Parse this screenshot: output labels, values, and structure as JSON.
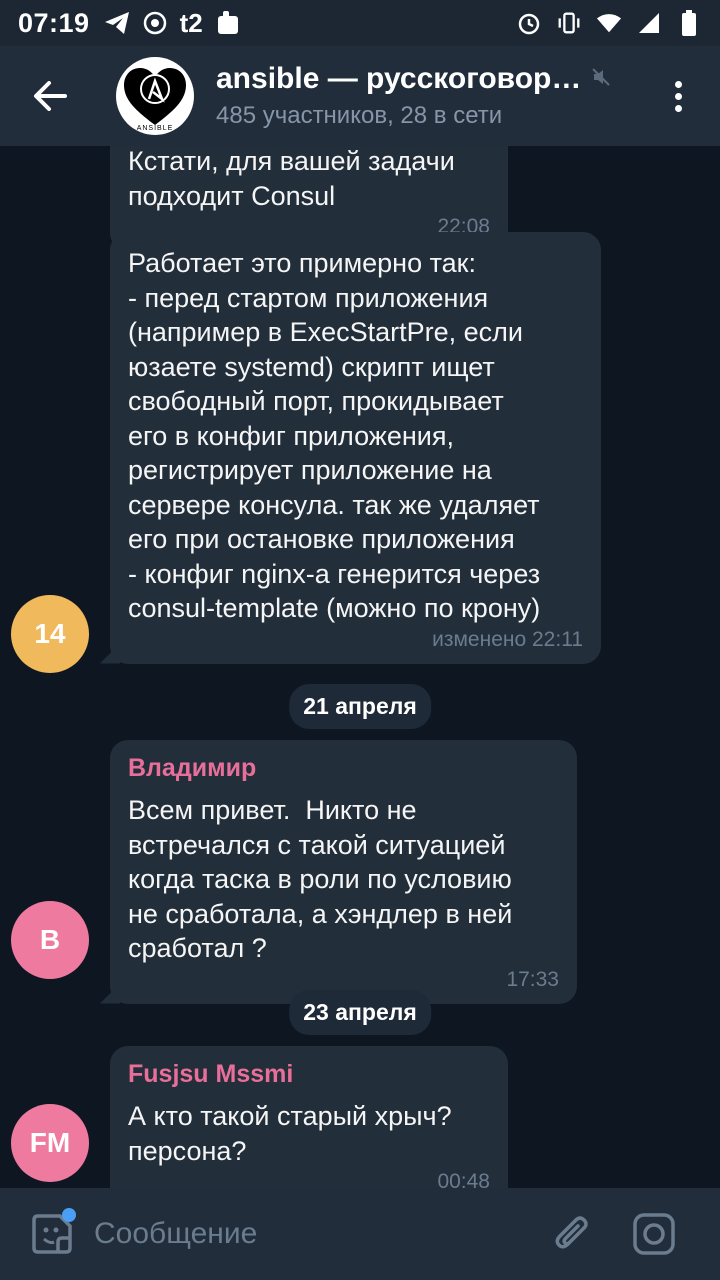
{
  "status_bar": {
    "time": "07:19",
    "carrier_badge": "t2"
  },
  "header": {
    "title": "ansible — русскоговор…",
    "subtitle": "485 участников, 28 в сети",
    "avatar_text": "ANSIBLE"
  },
  "messages": [
    {
      "text": "Кстати, для вашей задачи\nподходит Consul",
      "time": "22:08"
    },
    {
      "text": "Работает это примерно так:\n- перед стартом приложения\n(например в ExecStartPre, если\nюзаете systemd) скрипт ищет\nсвободный порт, прокидывает\nего в конфиг приложения,\nрегистрирует приложение на\nсервере консула. так же удаляет\nего при остановке приложения\n- конфиг nginx-а генерится через\nconsul-template (можно по крону)",
      "time": "изменено 22:11",
      "avatar_label": "14",
      "avatar_color": "#f0b95b"
    },
    {
      "date": "21 апреля"
    },
    {
      "sender": "Владимир",
      "text": "Всем привет.  Никто не\nвстречался с такой ситуацией\nкогда таска в роли по условию\nне сработала, а хэндлер в ней\nсработал ?",
      "time": "17:33",
      "avatar_label": "В",
      "avatar_color": "#ee7aa0"
    },
    {
      "date": "23 апреля"
    },
    {
      "sender": "Fusjsu Mssmi",
      "text": "А кто такой старый хрыч?\nперсона?",
      "time": "00:48",
      "avatar_label": "FM",
      "avatar_color": "#ee7aa0"
    }
  ],
  "composer": {
    "placeholder": "Сообщение"
  },
  "colors": {
    "sender_name": "#e86f9a",
    "bubble": "#222e3a",
    "background": "#0e1621",
    "accent": "#4a9ff5"
  },
  "icons": [
    "back-arrow-icon",
    "mute-icon",
    "more-vert-icon",
    "sticker-icon",
    "attach-icon",
    "camera-icon"
  ]
}
